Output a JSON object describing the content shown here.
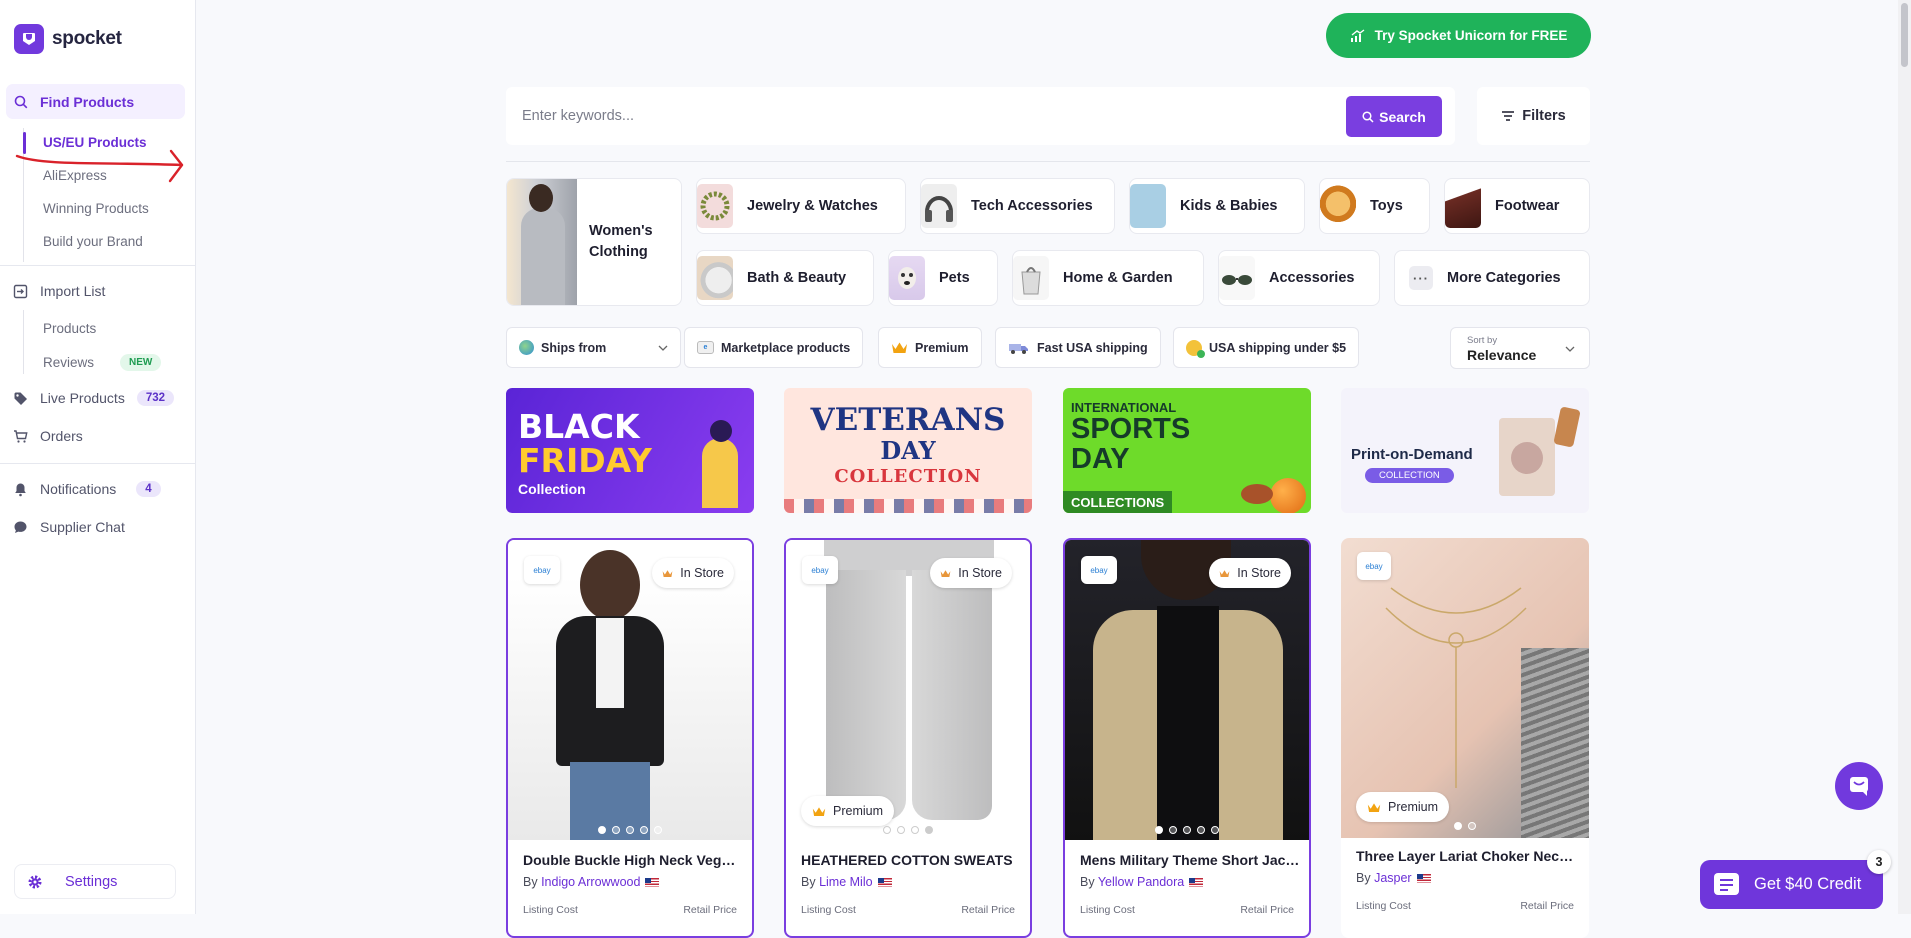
{
  "sidebar": {
    "brand": "spocket",
    "find_products": "Find Products",
    "sub_items": [
      "US/EU Products",
      "AliExpress",
      "Winning Products",
      "Build your Brand"
    ],
    "import_list": "Import List",
    "import_sub": [
      "Products",
      "Reviews"
    ],
    "reviews_badge": "NEW",
    "live_products": "Live Products",
    "live_count": "732",
    "orders": "Orders",
    "notifications": "Notifications",
    "notifications_count": "4",
    "supplier_chat": "Supplier Chat",
    "settings": "Settings"
  },
  "header": {
    "unicorn_cta": "Try Spocket Unicorn for FREE"
  },
  "search": {
    "placeholder": "Enter keywords...",
    "button": "Search",
    "filters": "Filters"
  },
  "categories": [
    "Women's Clothing",
    "Jewelry & Watches",
    "Tech Accessories",
    "Kids & Babies",
    "Toys",
    "Footwear",
    "Bath & Beauty",
    "Pets",
    "Home & Garden",
    "Accessories",
    "More Categories"
  ],
  "filter_chips": {
    "ships_from": "Ships from",
    "marketplace": "Marketplace products",
    "premium": "Premium",
    "fast_usa": "Fast USA shipping",
    "usa_under5": "USA shipping under $5",
    "sort_label": "Sort by",
    "sort_value": "Relevance"
  },
  "banners": {
    "bf_line1": "BLACK",
    "bf_line2": "FRIDAY",
    "bf_line3": "Collection",
    "vet_line1": "VETERANS",
    "vet_line2": "DAY",
    "vet_line3": "COLLECTION",
    "sports_line1": "INTERNATIONAL",
    "sports_line2": "SPORTS",
    "sports_line3": "DAY",
    "sports_line4": "COLLECTIONS",
    "pod_line1": "Print-on-Demand",
    "pod_line2": "COLLECTION"
  },
  "products": [
    {
      "title": "Double Buckle High Neck Vegan Leather Jacket",
      "by": "By",
      "supplier": "Indigo Arrowwood",
      "listing": "Listing Cost",
      "retail": "Retail Price",
      "badge": "In Store"
    },
    {
      "title": "HEATHERED COTTON SWEATS",
      "by": "By",
      "supplier": "Lime Milo",
      "listing": "Listing Cost",
      "retail": "Retail Price",
      "badge": "In Store",
      "premium": "Premium"
    },
    {
      "title": "Mens Military Theme Short Jacket",
      "by": "By",
      "supplier": "Yellow Pandora",
      "listing": "Listing Cost",
      "retail": "Retail Price",
      "badge": "In Store"
    },
    {
      "title": "Three Layer Lariat Choker Necklace",
      "by": "By",
      "supplier": "Jasper",
      "listing": "Listing Cost",
      "retail": "Retail Price",
      "premium": "Premium"
    }
  ],
  "credit": {
    "label": "Get $40 Credit",
    "count": "3"
  },
  "colors": {
    "accent": "#7139dd",
    "green": "#1fb35a",
    "annotation": "#d9222a"
  }
}
